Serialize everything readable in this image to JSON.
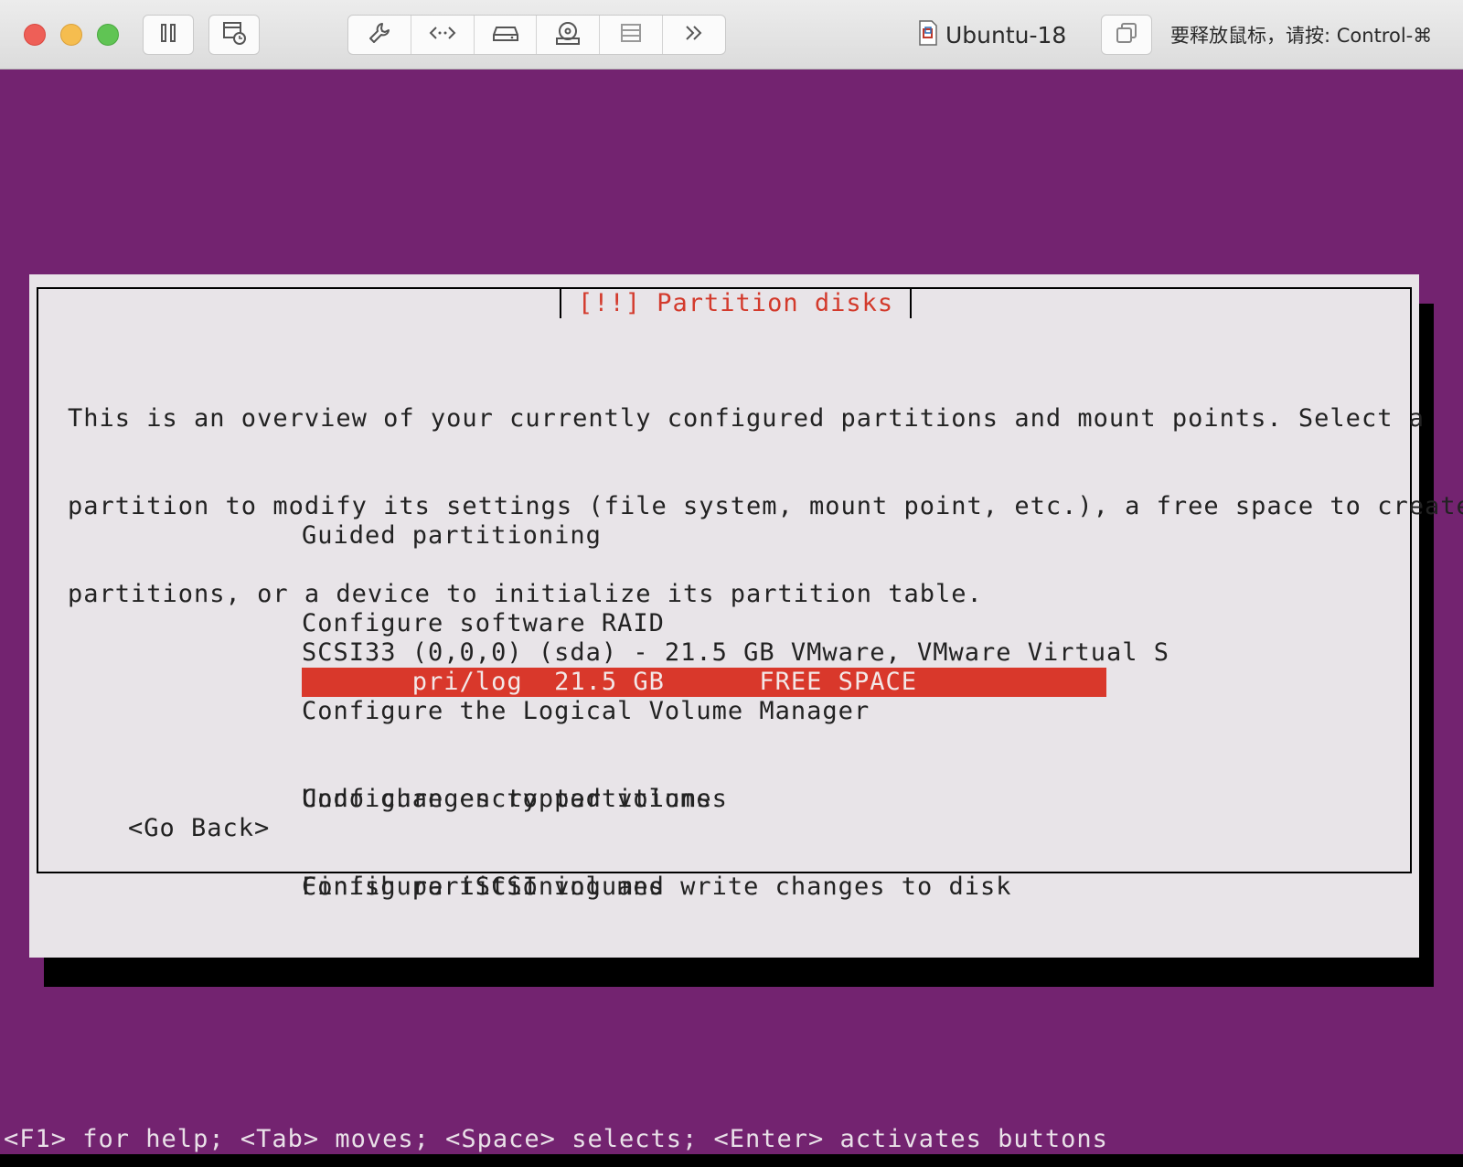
{
  "window": {
    "vm_name": "Ubuntu-18",
    "release_hint": "要释放鼠标，请按: Control-⌘",
    "toolbar": {
      "pause_icon": "pause-icon",
      "snapshot_icon": "snapshot-icon",
      "segment_icons": [
        "wrench-icon",
        "code-icon",
        "hard-disk-icon",
        "cd-drive-icon",
        "storage-icon",
        "more-icon"
      ],
      "window_icon": "window-duplicate-icon"
    }
  },
  "installer": {
    "dialog_title": "[!!] Partition disks",
    "intro_lines": [
      "This is an overview of your currently configured partitions and mount points. Select a",
      "partition to modify its settings (file system, mount point, etc.), a free space to create",
      "partitions, or a device to initialize its partition table."
    ],
    "menu_items": [
      "Guided partitioning",
      "Configure software RAID",
      "Configure the Logical Volume Manager",
      "Configure encrypted volumes",
      "Configure iSCSI volumes"
    ],
    "disk_line": "SCSI33 (0,0,0) (sda) - 21.5 GB VMware, VMware Virtual S",
    "free_space_line": "       pri/log  21.5 GB      FREE SPACE",
    "action_items": [
      "Undo changes to partitions",
      "Finish partitioning and write changes to disk"
    ],
    "go_back": "<Go Back>",
    "help_text": "<F1> for help; <Tab> moves; <Space> selects; <Enter> activates buttons"
  },
  "colors": {
    "background": "#732370",
    "dialog": "#e8e4e8",
    "title": "#d33a2c",
    "selection": "#d9382b"
  }
}
